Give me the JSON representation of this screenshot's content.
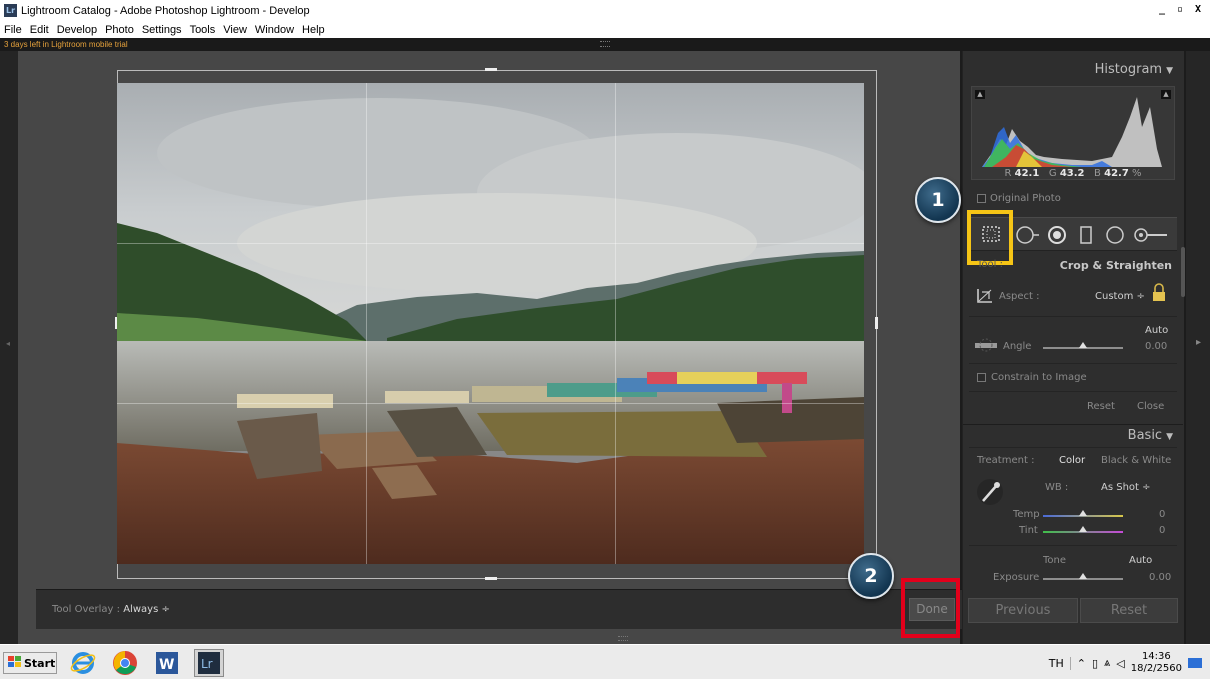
{
  "window": {
    "title": "Lightroom Catalog - Adobe Photoshop Lightroom - Develop",
    "app_icon": "Lr",
    "minimize": "_",
    "maximize": "х",
    "close": "X"
  },
  "menu": [
    "File",
    "Edit",
    "Develop",
    "Photo",
    "Settings",
    "Tools",
    "View",
    "Window",
    "Help"
  ],
  "trial_notice": "3 days left in Lightroom mobile trial",
  "histogram": {
    "title": "Histogram",
    "r_label": "R",
    "r_value": "42.1",
    "g_label": "G",
    "g_value": "43.2",
    "b_label": "B",
    "b_value": "42.7",
    "unit": "%",
    "original_photo": "Original Photo"
  },
  "crop": {
    "tool_label": "Tool :",
    "title": "Crop & Straighten",
    "aspect_label": "Aspect :",
    "aspect_value": "Custom ÷",
    "auto": "Auto",
    "angle_label": "Angle",
    "angle_value": "0.00",
    "angle_level": 0.5,
    "constrain": "Constrain to Image",
    "reset": "Reset",
    "close": "Close"
  },
  "basic": {
    "title": "Basic",
    "treatment_label": "Treatment :",
    "color": "Color",
    "bw": "Black & White",
    "wb_label": "WB :",
    "wb_value": "As Shot ÷",
    "temp_label": "Temp",
    "temp_value": "0",
    "tint_label": "Tint",
    "tint_value": "0",
    "tone_label": "Tone",
    "tone_auto": "Auto",
    "exposure_label": "Exposure",
    "exposure_value": "0.00"
  },
  "bottom": {
    "tool_overlay_label": "Tool Overlay :",
    "tool_overlay_value": "Always ÷",
    "done": "Done",
    "previous": "Previous",
    "reset": "Reset"
  },
  "badges": {
    "one": "1",
    "two": "2"
  },
  "taskbar": {
    "start": "Start",
    "lang": "TH",
    "time": "14:36",
    "date": "18/2/2560",
    "lr_label": "Lr"
  },
  "colors": {
    "trial_text": "#e6a23c",
    "highlight_red": "#e3001b",
    "highlight_yellow": "#f6c516",
    "badge_fill": "#123550"
  }
}
